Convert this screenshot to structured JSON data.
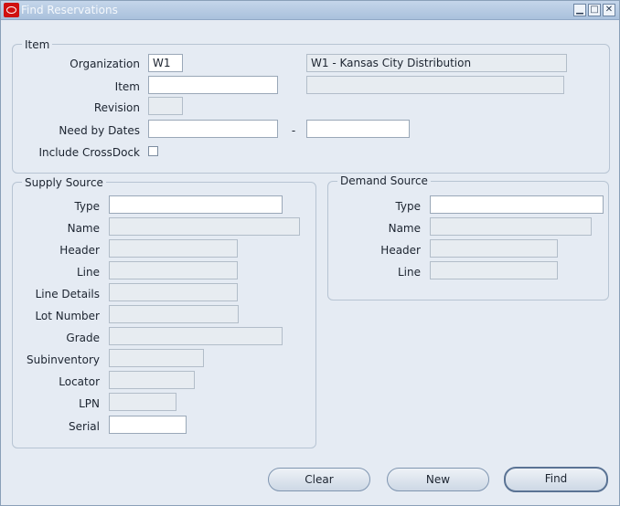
{
  "window": {
    "title": "Find Reservations"
  },
  "item_group": {
    "legend": "Item",
    "organization": {
      "label": "Organization",
      "code": "W1",
      "description": "W1 - Kansas City Distribution"
    },
    "item": {
      "label": "Item",
      "value": "",
      "description": ""
    },
    "revision": {
      "label": "Revision",
      "value": ""
    },
    "need_by_dates": {
      "label": "Need by Dates",
      "from": "",
      "separator": "-",
      "to": ""
    },
    "crossdock": {
      "label": "Include CrossDock",
      "checked": false
    }
  },
  "supply_source": {
    "legend": "Supply Source",
    "type": {
      "label": "Type",
      "value": ""
    },
    "name": {
      "label": "Name",
      "value": ""
    },
    "header": {
      "label": "Header",
      "value": ""
    },
    "line": {
      "label": "Line",
      "value": ""
    },
    "line_details": {
      "label": "Line Details",
      "value": ""
    },
    "lot_number": {
      "label": "Lot Number",
      "value": ""
    },
    "grade": {
      "label": "Grade",
      "value": ""
    },
    "subinventory": {
      "label": "Subinventory",
      "value": ""
    },
    "locator": {
      "label": "Locator",
      "value": ""
    },
    "lpn": {
      "label": "LPN",
      "value": ""
    },
    "serial": {
      "label": "Serial",
      "value": ""
    }
  },
  "demand_source": {
    "legend": "Demand Source",
    "type": {
      "label": "Type",
      "value": ""
    },
    "name": {
      "label": "Name",
      "value": ""
    },
    "header": {
      "label": "Header",
      "value": ""
    },
    "line": {
      "label": "Line",
      "value": ""
    }
  },
  "buttons": {
    "clear": "Clear",
    "new": "New",
    "find": "Find"
  },
  "icons": {
    "app": "oracle-logo-icon",
    "minimize": "minimize-icon",
    "maximize": "maximize-icon",
    "close": "close-icon"
  }
}
